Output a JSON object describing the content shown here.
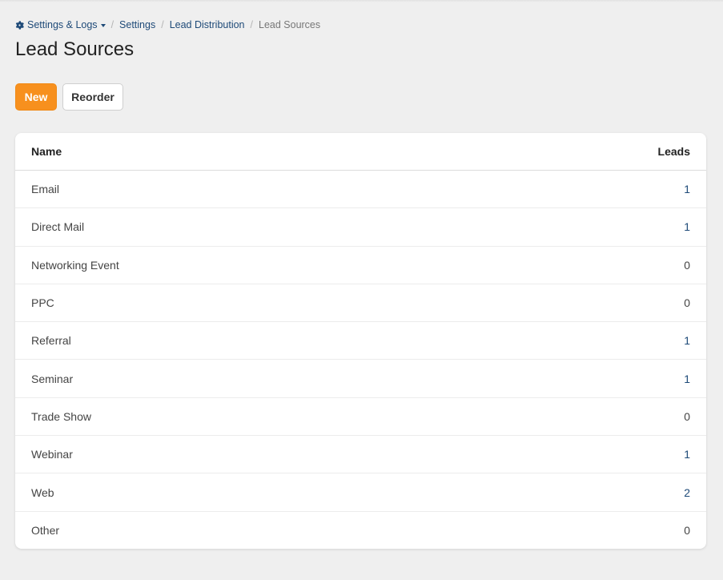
{
  "breadcrumb": {
    "root_label": "Settings & Logs",
    "items": [
      "Settings",
      "Lead Distribution"
    ],
    "current": "Lead Sources"
  },
  "page_title": "Lead Sources",
  "toolbar": {
    "new_label": "New",
    "reorder_label": "Reorder"
  },
  "table": {
    "headers": {
      "name": "Name",
      "leads": "Leads"
    },
    "rows": [
      {
        "name": "Email",
        "leads": "1"
      },
      {
        "name": "Direct Mail",
        "leads": "1"
      },
      {
        "name": "Networking Event",
        "leads": "0"
      },
      {
        "name": "PPC",
        "leads": "0"
      },
      {
        "name": "Referral",
        "leads": "1"
      },
      {
        "name": "Seminar",
        "leads": "1"
      },
      {
        "name": "Trade Show",
        "leads": "0"
      },
      {
        "name": "Webinar",
        "leads": "1"
      },
      {
        "name": "Web",
        "leads": "2"
      },
      {
        "name": "Other",
        "leads": "0"
      }
    ]
  },
  "colors": {
    "accent": "#f7901e",
    "link": "#1e4a78",
    "background": "#efefef"
  },
  "icons": {
    "settings_menu": "gear-icon",
    "dropdown": "caret-down-icon"
  }
}
